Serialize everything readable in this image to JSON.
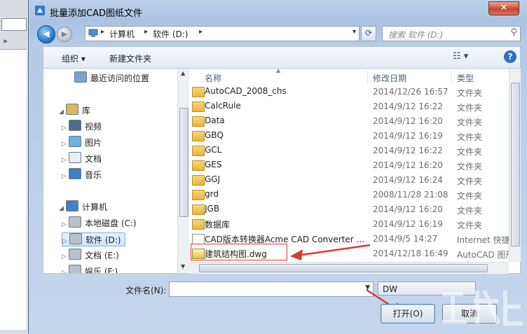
{
  "window": {
    "title": "批量添加CAD图纸文件",
    "close_label": "✕"
  },
  "background_app": {
    "toolbar_glyph": "»"
  },
  "address": {
    "segments": [
      "计算机",
      "软件 (D:)"
    ],
    "separator": "▸"
  },
  "search": {
    "placeholder": "搜索 软件 (D:)"
  },
  "toolbar": {
    "organize": "组织 ▾",
    "new_folder": "新建文件夹",
    "view_glyph": "☷ ▾",
    "help": "?"
  },
  "nav": [
    {
      "label": "最近访问的位置",
      "icon": "recent-places-icon",
      "expander": ""
    },
    {
      "label": "库",
      "icon": "library-icon",
      "expander": "◢"
    },
    {
      "label": "视频",
      "icon": "video-icon",
      "expander": "▷"
    },
    {
      "label": "图片",
      "icon": "pictures-icon",
      "expander": "▷"
    },
    {
      "label": "文档",
      "icon": "documents-icon",
      "expander": "▷"
    },
    {
      "label": "音乐",
      "icon": "music-icon",
      "expander": "▷"
    },
    {
      "label": "计算机",
      "icon": "computer-icon",
      "expander": "◢"
    },
    {
      "label": "本地磁盘 (C:)",
      "icon": "drive-icon",
      "expander": "▷"
    },
    {
      "label": "软件 (D:)",
      "icon": "drive-icon",
      "expander": "▷",
      "selected": true
    },
    {
      "label": "文档 (E:)",
      "icon": "drive-icon",
      "expander": "▷"
    },
    {
      "label": "娱乐 (F:)",
      "icon": "drive-icon",
      "expander": "▷"
    }
  ],
  "columns": {
    "name": "名称",
    "date": "修改日期",
    "type": "类型"
  },
  "files": [
    {
      "name": "AutoCAD_2008_chs",
      "date": "2014/12/26 16:57",
      "type": "文件夹",
      "kind": "folder"
    },
    {
      "name": "CalcRule",
      "date": "2014/9/12 16:22",
      "type": "文件夹",
      "kind": "folder"
    },
    {
      "name": "Data",
      "date": "2014/9/12 16:20",
      "type": "文件夹",
      "kind": "folder"
    },
    {
      "name": "GBQ",
      "date": "2014/9/12 16:19",
      "type": "文件夹",
      "kind": "folder"
    },
    {
      "name": "GCL",
      "date": "2014/9/12 16:22",
      "type": "文件夹",
      "kind": "folder"
    },
    {
      "name": "GES",
      "date": "2014/9/12 16:20",
      "type": "文件夹",
      "kind": "folder"
    },
    {
      "name": "GGJ",
      "date": "2014/9/12 16:24",
      "type": "文件夹",
      "kind": "folder"
    },
    {
      "name": "grd",
      "date": "2008/11/28 21:08",
      "type": "文件夹",
      "kind": "folder"
    },
    {
      "name": "JGB",
      "date": "2014/9/12 16:20",
      "type": "文件夹",
      "kind": "folder"
    },
    {
      "name": "数据库",
      "date": "2014/9/12 16:19",
      "type": "文件夹",
      "kind": "folder"
    },
    {
      "name": "CAD版本转换器Acme CAD Converter ...",
      "date": "2014/9/5 14:27",
      "type": "Internet 快捷方式",
      "kind": "doc"
    },
    {
      "name": "建筑结构图.dwg",
      "date": "2014/12/18 16:49",
      "type": "AutoCAD 图形",
      "kind": "dwg"
    }
  ],
  "bottom": {
    "filename_label": "文件名(N):",
    "filename_value": "",
    "filter_value": "DW",
    "open_button": "打开(O)",
    "cancel_button": "取消"
  },
  "colors": {
    "highlight": "#d63b32",
    "selection": "#cfe5fb",
    "folder": "#e8b43d"
  }
}
